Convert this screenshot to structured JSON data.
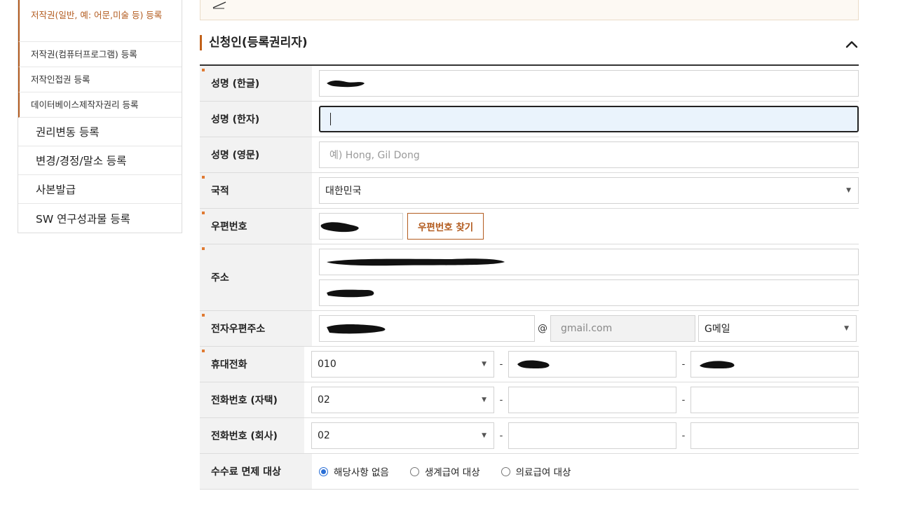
{
  "sidebar": {
    "sub_items": [
      {
        "label": "저작권(일반, 예: 어문,미술 등) 등록"
      },
      {
        "label": "저작권(컴퓨터프로그램) 등록"
      },
      {
        "label": "저작인접권 등록"
      },
      {
        "label": "데이터베이스제작자권리 등록"
      }
    ],
    "main_items": [
      {
        "label": "권리변동 등록"
      },
      {
        "label": "변경/경정/말소 등록"
      },
      {
        "label": "사본발급"
      },
      {
        "label": "SW 연구성과물 등록"
      }
    ]
  },
  "section": {
    "title": "신청인(등록권리자)"
  },
  "form": {
    "name_kr": {
      "label": "성명 (한글)"
    },
    "name_hanja": {
      "label": "성명 (한자)"
    },
    "name_en": {
      "label": "성명 (영문)",
      "placeholder": "예) Hong, Gil Dong"
    },
    "nationality": {
      "label": "국적",
      "value": "대한민국"
    },
    "zipcode": {
      "label": "우편번호",
      "button": "우편번호 찾기"
    },
    "address": {
      "label": "주소"
    },
    "email": {
      "label": "전자우편주소",
      "at": "@",
      "domain": "gmail.com",
      "provider": "G메일"
    },
    "mobile": {
      "label": "휴대전화",
      "prefix": "010",
      "sep": "-"
    },
    "phone_home": {
      "label": "전화번호 (자택)",
      "prefix": "02",
      "sep": "-"
    },
    "phone_work": {
      "label": "전화번호 (회사)",
      "prefix": "02",
      "sep": "-"
    },
    "fee_exempt": {
      "label": "수수료 면제 대상",
      "options": [
        {
          "label": "해당사항 없음",
          "checked": true
        },
        {
          "label": "생계급여 대상",
          "checked": false
        },
        {
          "label": "의료급여 대상",
          "checked": false
        }
      ]
    }
  }
}
